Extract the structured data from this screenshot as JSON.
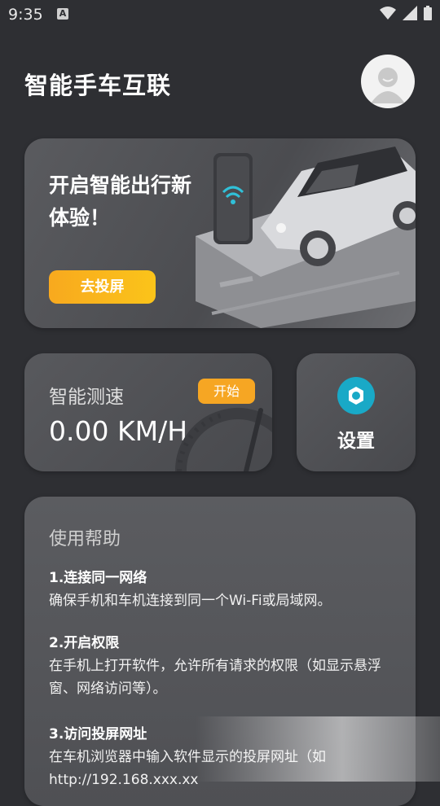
{
  "status_bar": {
    "time": "9:35",
    "notification_letter": "A"
  },
  "header": {
    "title": "智能手车互联"
  },
  "banner": {
    "title": "开启智能出行新体验！",
    "button_label": "去投屏"
  },
  "speed_card": {
    "label": "智能测速",
    "start_label": "开始",
    "value": "0.00 KM/H"
  },
  "settings_card": {
    "label": "设置"
  },
  "help": {
    "title": "使用帮助",
    "items": [
      {
        "heading": "1.连接同一网络",
        "text": "确保手机和车机连接到同一个Wi-Fi或局域网。"
      },
      {
        "heading": "2.开启权限",
        "text": "在手机上打开软件，允许所有请求的权限（如显示悬浮窗、网络访问等）。"
      },
      {
        "heading": "3.访问投屏网址",
        "text": "在车机浏览器中输入软件显示的投屏网址（如http://192.168.xxx.xx"
      }
    ]
  },
  "colors": {
    "background": "#2e2f33",
    "accent_orange": "#f6a623",
    "settings_blue": "#19a9c7"
  }
}
